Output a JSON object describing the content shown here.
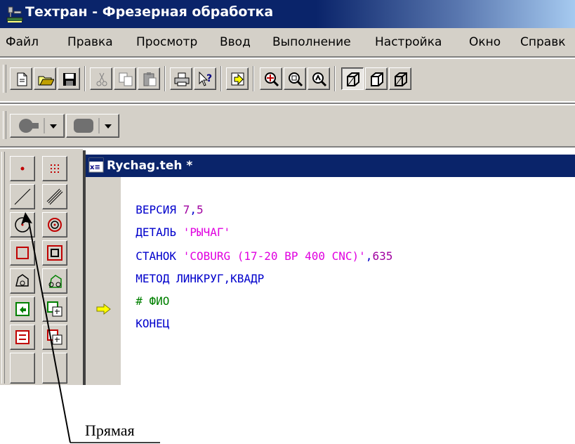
{
  "window": {
    "title": "Техтран - Фрезерная обработка",
    "icon": "milling-machine-icon"
  },
  "menu": {
    "items": [
      "Файл",
      "Правка",
      "Просмотр",
      "Ввод",
      "Выполнение",
      "Настройка",
      "Окно",
      "Справк"
    ]
  },
  "toolbar_main": {
    "buttons": [
      "new-file-icon",
      "open-folder-icon",
      "save-disk-icon",
      "cut-icon",
      "copy-icon",
      "paste-icon",
      "print-icon",
      "help-pointer-icon",
      "run-icon",
      "zoom-in-icon",
      "zoom-out-icon",
      "zoom-fit-icon",
      "cube-view-1-icon",
      "cube-view-2-icon",
      "cube-view-3-icon"
    ]
  },
  "toolbar_secondary": {
    "buttons": [
      "shape-circle-dropdown-icon",
      "shape-rounded-dropdown-icon"
    ]
  },
  "palette": {
    "buttons": [
      "point-icon",
      "point-grid-icon",
      "line-icon",
      "parallel-lines-icon",
      "circle-icon",
      "concentric-circles-icon",
      "rectangle-icon",
      "nested-rectangles-icon",
      "contour-icon",
      "contour-offset-icon",
      "frame-left-icon",
      "frame-copy-icon",
      "frame-back-icon",
      "frame-copy-2-icon"
    ]
  },
  "editor": {
    "file_title": "Rychag.teh *",
    "current_line_marker": "arrow-right-icon",
    "lines": [
      [
        {
          "t": "ВЕРСИЯ ",
          "c": "kw"
        },
        {
          "t": "7",
          "c": "num"
        },
        {
          "t": ",",
          "c": "kw"
        },
        {
          "t": "5",
          "c": "num"
        }
      ],
      [
        {
          "t": "ДЕТАЛЬ ",
          "c": "kw"
        },
        {
          "t": "'РЫЧАГ'",
          "c": "str"
        }
      ],
      [
        {
          "t": "СТАНОК ",
          "c": "kw"
        },
        {
          "t": "'COBURG (17-20 BP 400 CNC)'",
          "c": "str"
        },
        {
          "t": ",",
          "c": "kw"
        },
        {
          "t": "635",
          "c": "num"
        }
      ],
      [
        {
          "t": "МЕТОД ЛИНКРУГ,КВАДР",
          "c": "kw"
        }
      ],
      [
        {
          "t": "# ФИО",
          "c": "com"
        }
      ],
      [
        {
          "t": "КОНЕЦ",
          "c": "kw"
        }
      ]
    ]
  },
  "annotation": {
    "label": "Прямая"
  },
  "colors": {
    "title_bar": "#0a246a",
    "face": "#d4d0c8",
    "keyword": "#0000cc",
    "string": "#e000e0",
    "comment": "#008000",
    "marker": "#ffff00"
  }
}
